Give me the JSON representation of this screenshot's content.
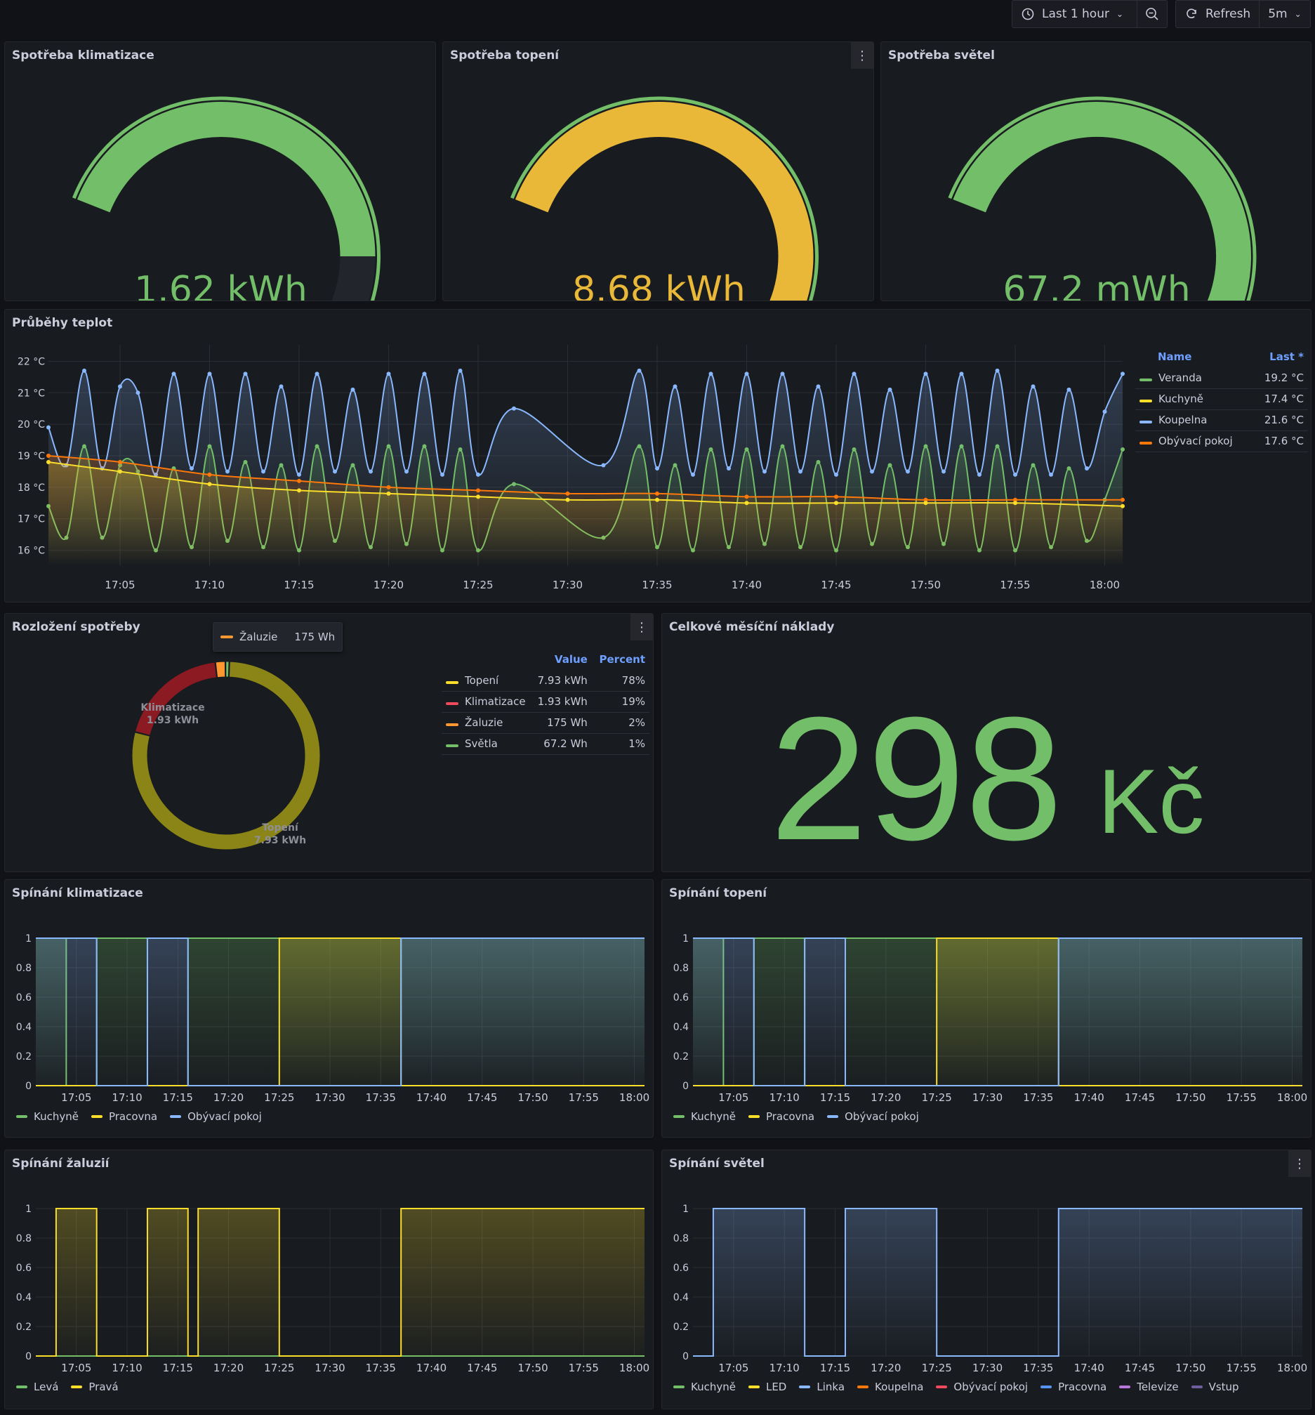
{
  "toolbar": {
    "time_range": "Last 1 hour",
    "refresh_label": "Refresh",
    "refresh_interval": "5m"
  },
  "gauges": [
    {
      "title": "Spotřeba klimatizace",
      "value": "1.62 kWh",
      "fraction": 0.5,
      "color": "#73bf69"
    },
    {
      "title": "Spotřeba topení",
      "value": "8.68 kWh",
      "fraction": 0.8,
      "color": "#eab839"
    },
    {
      "title": "Spotřeba světel",
      "value": "67.2 mWh",
      "fraction": 0.74,
      "color": "#73bf69"
    }
  ],
  "temps": {
    "title": "Průběhy teplot",
    "legend_header": {
      "name": "Name",
      "last": "Last *"
    },
    "legend": [
      {
        "name": "Veranda",
        "last": "19.2 °C",
        "color": "#73bf69"
      },
      {
        "name": "Kuchyně",
        "last": "17.4 °C",
        "color": "#fade2a"
      },
      {
        "name": "Koupelna",
        "last": "21.6 °C",
        "color": "#8ab8ff"
      },
      {
        "name": "Obývací pokoj",
        "last": "17.6 °C",
        "color": "#ff780a"
      }
    ]
  },
  "donut": {
    "title": "Rozložení spotřeby",
    "tooltip": {
      "name": "Žaluzie",
      "value": "175 Wh"
    },
    "header": {
      "value": "Value",
      "percent": "Percent"
    },
    "rows": [
      {
        "name": "Topení",
        "value": "7.93 kWh",
        "percent": "78%",
        "color": "#fade2a"
      },
      {
        "name": "Klimatizace",
        "value": "1.93 kWh",
        "percent": "19%",
        "color": "#f2495c"
      },
      {
        "name": "Žaluzie",
        "value": "175 Wh",
        "percent": "2%",
        "color": "#ff9830"
      },
      {
        "name": "Světla",
        "value": "67.2 Wh",
        "percent": "1%",
        "color": "#73bf69"
      }
    ],
    "label_klim": {
      "name": "Klimatizace",
      "value": "1.93 kWh"
    },
    "label_top": {
      "name": "Topení",
      "value": "7.93 kWh"
    }
  },
  "costs": {
    "title": "Celkové měsíční náklady",
    "value": "298",
    "unit": "Kč"
  },
  "switch_panels": [
    {
      "title": "Spínání klimatizace",
      "legend": [
        {
          "name": "Kuchyně",
          "color": "#73bf69"
        },
        {
          "name": "Pracovna",
          "color": "#fade2a"
        },
        {
          "name": "Obývací pokoj",
          "color": "#8ab8ff"
        }
      ]
    },
    {
      "title": "Spínání topení",
      "legend": [
        {
          "name": "Kuchyně",
          "color": "#73bf69"
        },
        {
          "name": "Pracovna",
          "color": "#fade2a"
        },
        {
          "name": "Obývací pokoj",
          "color": "#8ab8ff"
        }
      ]
    },
    {
      "title": "Spínání žaluzií",
      "legend": [
        {
          "name": "Levá",
          "color": "#73bf69"
        },
        {
          "name": "Pravá",
          "color": "#fade2a"
        }
      ]
    },
    {
      "title": "Spínání světel",
      "legend": [
        {
          "name": "Kuchyně",
          "color": "#73bf69"
        },
        {
          "name": "LED",
          "color": "#fade2a"
        },
        {
          "name": "Linka",
          "color": "#8ab8ff"
        },
        {
          "name": "Koupelna",
          "color": "#ff780a"
        },
        {
          "name": "Obývací pokoj",
          "color": "#f2495c"
        },
        {
          "name": "Pracovna",
          "color": "#5794f2"
        },
        {
          "name": "Televize",
          "color": "#b877d9"
        },
        {
          "name": "Vstup",
          "color": "#705da0"
        }
      ]
    }
  ],
  "chart_data": [
    {
      "type": "line",
      "title": "Průběhy teplot",
      "x_ticks": [
        "17:05",
        "17:10",
        "17:15",
        "17:20",
        "17:25",
        "17:30",
        "17:35",
        "17:40",
        "17:45",
        "17:50",
        "17:55",
        "18:00"
      ],
      "y_ticks": [
        "16 °C",
        "17 °C",
        "18 °C",
        "19 °C",
        "20 °C",
        "21 °C",
        "22 °C"
      ],
      "ylim": [
        15.5,
        22.3
      ],
      "series": [
        {
          "name": "Koupelna",
          "color": "#8ab8ff",
          "x": [
            "17:01",
            "17:02",
            "17:03",
            "17:04",
            "17:05",
            "17:06",
            "17:07",
            "17:08",
            "17:09",
            "17:10",
            "17:11",
            "17:12",
            "17:13",
            "17:14",
            "17:15",
            "17:16",
            "17:17",
            "17:18",
            "17:19",
            "17:20",
            "17:21",
            "17:22",
            "17:23",
            "17:24",
            "17:25",
            "17:27",
            "17:32",
            "17:34",
            "17:35",
            "17:36",
            "17:37",
            "17:38",
            "17:39",
            "17:40",
            "17:41",
            "17:42",
            "17:43",
            "17:44",
            "17:45",
            "17:46",
            "17:47",
            "17:48",
            "17:49",
            "17:50",
            "17:51",
            "17:52",
            "17:53",
            "17:54",
            "17:55",
            "17:56",
            "17:57",
            "17:58",
            "17:59",
            "18:00",
            "18:01"
          ],
          "values": [
            19.9,
            18.7,
            21.7,
            18.6,
            21.2,
            21.0,
            18.4,
            21.6,
            18.6,
            21.6,
            18.5,
            21.6,
            18.5,
            21.2,
            18.4,
            21.6,
            18.5,
            21.1,
            18.5,
            21.6,
            18.5,
            21.6,
            18.4,
            21.7,
            18.4,
            20.5,
            18.7,
            21.7,
            18.6,
            21.2,
            18.4,
            21.6,
            18.6,
            21.6,
            18.5,
            21.6,
            18.5,
            21.2,
            18.4,
            21.6,
            18.5,
            21.1,
            18.5,
            21.6,
            18.5,
            21.6,
            18.4,
            21.7,
            18.4,
            21.2,
            18.4,
            21.1,
            18.6,
            20.4,
            21.6
          ]
        },
        {
          "name": "Veranda",
          "color": "#73bf69",
          "x": [
            "17:01",
            "17:02",
            "17:03",
            "17:04",
            "17:05",
            "17:06",
            "17:07",
            "17:08",
            "17:09",
            "17:10",
            "17:11",
            "17:12",
            "17:13",
            "17:14",
            "17:15",
            "17:16",
            "17:17",
            "17:18",
            "17:19",
            "17:20",
            "17:21",
            "17:22",
            "17:23",
            "17:24",
            "17:25",
            "17:27",
            "17:32",
            "17:34",
            "17:35",
            "17:36",
            "17:37",
            "17:38",
            "17:39",
            "17:40",
            "17:41",
            "17:42",
            "17:43",
            "17:44",
            "17:45",
            "17:46",
            "17:47",
            "17:48",
            "17:49",
            "17:50",
            "17:51",
            "17:52",
            "17:53",
            "17:54",
            "17:55",
            "17:56",
            "17:57",
            "17:58",
            "17:59",
            "18:00",
            "18:01"
          ],
          "values": [
            17.4,
            16.4,
            19.3,
            16.4,
            18.7,
            18.5,
            16.0,
            18.6,
            16.1,
            19.3,
            16.3,
            18.8,
            16.1,
            18.7,
            16.0,
            19.3,
            16.3,
            18.7,
            16.1,
            19.3,
            16.2,
            19.3,
            16.0,
            19.2,
            16.0,
            18.1,
            16.4,
            19.3,
            16.1,
            18.7,
            16.0,
            19.2,
            16.1,
            19.2,
            16.2,
            19.3,
            16.1,
            18.8,
            16.0,
            19.2,
            16.2,
            18.7,
            16.1,
            19.3,
            16.2,
            19.3,
            16.0,
            19.3,
            16.0,
            18.7,
            16.1,
            18.6,
            16.3,
            17.6,
            19.2
          ]
        },
        {
          "name": "Obývací pokoj",
          "color": "#ff780a",
          "x": [
            "17:01",
            "17:05",
            "17:10",
            "17:15",
            "17:20",
            "17:25",
            "17:30",
            "17:35",
            "17:40",
            "17:45",
            "17:50",
            "17:55",
            "18:01"
          ],
          "values": [
            19.0,
            18.8,
            18.4,
            18.2,
            18.0,
            17.9,
            17.8,
            17.8,
            17.7,
            17.7,
            17.6,
            17.6,
            17.6
          ]
        },
        {
          "name": "Kuchyně",
          "color": "#fade2a",
          "x": [
            "17:01",
            "17:05",
            "17:10",
            "17:15",
            "17:20",
            "17:25",
            "17:30",
            "17:35",
            "17:40",
            "17:45",
            "17:50",
            "17:55",
            "18:01"
          ],
          "values": [
            18.8,
            18.5,
            18.1,
            17.9,
            17.8,
            17.7,
            17.6,
            17.6,
            17.5,
            17.5,
            17.5,
            17.5,
            17.4
          ]
        }
      ]
    },
    {
      "type": "pie",
      "title": "Rozložení spotřeby",
      "categories": [
        "Topení",
        "Klimatizace",
        "Žaluzie",
        "Světla"
      ],
      "values": [
        7.93,
        1.93,
        0.175,
        0.0672
      ]
    },
    {
      "type": "area",
      "title": "Spínání klimatizace",
      "x_ticks": [
        "17:05",
        "17:10",
        "17:15",
        "17:20",
        "17:25",
        "17:30",
        "17:35",
        "17:40",
        "17:45",
        "17:50",
        "17:55",
        "18:00"
      ],
      "y_ticks": [
        "0",
        "0.2",
        "0.4",
        "0.6",
        "0.8",
        "1"
      ],
      "ylim": [
        0,
        1
      ],
      "series": [
        {
          "name": "Kuchyně",
          "color": "#73bf69",
          "steps": [
            [
              "17:01",
              1
            ],
            [
              "17:04",
              0
            ],
            [
              "17:07",
              1
            ],
            [
              "17:12",
              0
            ],
            [
              "17:16",
              1
            ],
            [
              "18:01",
              1
            ]
          ]
        },
        {
          "name": "Pracovna",
          "color": "#fade2a",
          "steps": [
            [
              "17:01",
              0
            ],
            [
              "17:25",
              1
            ],
            [
              "17:37",
              0
            ],
            [
              "18:01",
              0
            ]
          ]
        },
        {
          "name": "Obývací pokoj",
          "color": "#8ab8ff",
          "steps": [
            [
              "17:01",
              1
            ],
            [
              "17:04",
              1
            ],
            [
              "17:07",
              0
            ],
            [
              "17:12",
              1
            ],
            [
              "17:16",
              0
            ],
            [
              "17:37",
              1
            ],
            [
              "18:01",
              1
            ]
          ]
        }
      ]
    },
    {
      "type": "area",
      "title": "Spínání topení",
      "x_ticks": [
        "17:05",
        "17:10",
        "17:15",
        "17:20",
        "17:25",
        "17:30",
        "17:35",
        "17:40",
        "17:45",
        "17:50",
        "17:55",
        "18:00"
      ],
      "y_ticks": [
        "0",
        "0.2",
        "0.4",
        "0.6",
        "0.8",
        "1"
      ],
      "ylim": [
        0,
        1
      ],
      "series": [
        {
          "name": "Kuchyně",
          "color": "#73bf69",
          "steps": [
            [
              "17:01",
              1
            ],
            [
              "17:04",
              0
            ],
            [
              "17:07",
              1
            ],
            [
              "17:12",
              0
            ],
            [
              "17:16",
              1
            ],
            [
              "18:01",
              1
            ]
          ]
        },
        {
          "name": "Pracovna",
          "color": "#fade2a",
          "steps": [
            [
              "17:01",
              0
            ],
            [
              "17:25",
              1
            ],
            [
              "17:37",
              0
            ],
            [
              "18:01",
              0
            ]
          ]
        },
        {
          "name": "Obývací pokoj",
          "color": "#8ab8ff",
          "steps": [
            [
              "17:01",
              1
            ],
            [
              "17:04",
              1
            ],
            [
              "17:07",
              0
            ],
            [
              "17:12",
              1
            ],
            [
              "17:16",
              0
            ],
            [
              "17:37",
              1
            ],
            [
              "18:01",
              1
            ]
          ]
        }
      ]
    },
    {
      "type": "area",
      "title": "Spínání žaluzií",
      "x_ticks": [
        "17:05",
        "17:10",
        "17:15",
        "17:20",
        "17:25",
        "17:30",
        "17:35",
        "17:40",
        "17:45",
        "17:50",
        "17:55",
        "18:00"
      ],
      "y_ticks": [
        "0",
        "0.2",
        "0.4",
        "0.6",
        "0.8",
        "1"
      ],
      "ylim": [
        0,
        1
      ],
      "series": [
        {
          "name": "Levá",
          "color": "#73bf69",
          "steps": [
            [
              "17:01",
              0
            ],
            [
              "18:01",
              0
            ]
          ]
        },
        {
          "name": "Pravá",
          "color": "#fade2a",
          "steps": [
            [
              "17:01",
              0
            ],
            [
              "17:03",
              1
            ],
            [
              "17:07",
              0
            ],
            [
              "17:12",
              1
            ],
            [
              "17:16",
              0
            ],
            [
              "17:17",
              1
            ],
            [
              "17:25",
              0
            ],
            [
              "17:37",
              1
            ],
            [
              "18:01",
              1
            ]
          ]
        }
      ]
    },
    {
      "type": "area",
      "title": "Spínání světel",
      "x_ticks": [
        "17:05",
        "17:10",
        "17:15",
        "17:20",
        "17:25",
        "17:30",
        "17:35",
        "17:40",
        "17:45",
        "17:50",
        "17:55",
        "18:00"
      ],
      "y_ticks": [
        "0",
        "0.2",
        "0.4",
        "0.6",
        "0.8",
        "1"
      ],
      "ylim": [
        0,
        1
      ],
      "series": [
        {
          "name": "Linka",
          "color": "#8ab8ff",
          "steps": [
            [
              "17:01",
              0
            ],
            [
              "17:03",
              1
            ],
            [
              "17:12",
              0
            ],
            [
              "17:16",
              1
            ],
            [
              "17:25",
              0
            ],
            [
              "17:37",
              1
            ],
            [
              "18:01",
              1
            ]
          ]
        }
      ]
    }
  ]
}
